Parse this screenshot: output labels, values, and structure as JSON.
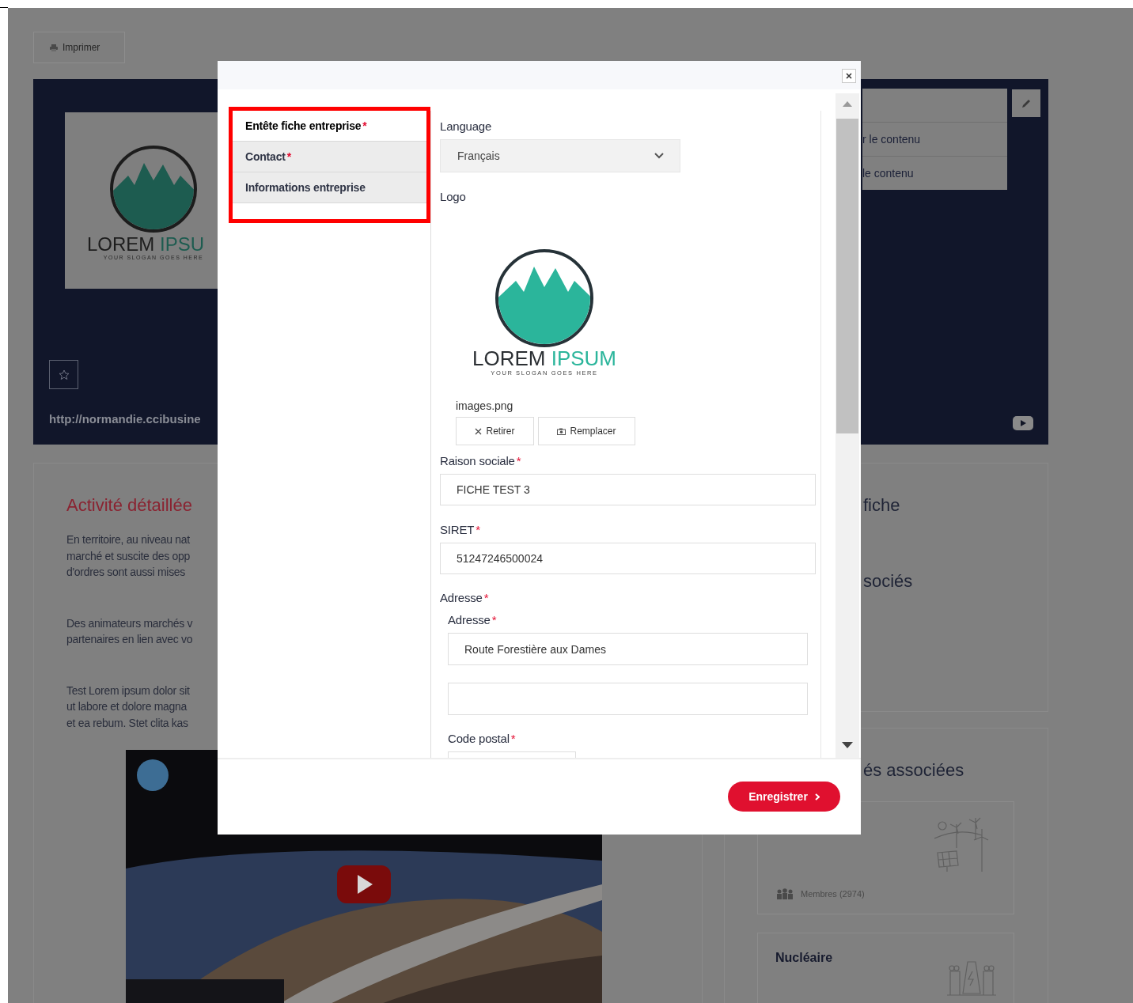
{
  "toolbar": {
    "print_button": "Imprimer"
  },
  "hero": {
    "logo": {
      "name_part_1": "LOREM",
      "name_part_2": "IPSU",
      "slogan": "YOUR SLOGAN GOES HERE"
    },
    "url": "http://normandie.ccibusine",
    "menu_items": [
      "r le contenu",
      "le contenu"
    ]
  },
  "activity": {
    "title": "Activité détaillée",
    "paragraphs": [
      [
        "En territoire, au niveau nat",
        "marché et suscite des opp",
        "d'ordres sont aussi mises"
      ],
      [
        "Des animateurs marchés v",
        "partenaires en lien avec vo"
      ],
      [
        "Test Lorem ipsum dolor sit",
        "ut labore et dolore magna",
        "et ea rebum. Stet clita kas"
      ]
    ],
    "video": {
      "kind": "picture"
    }
  },
  "side_panel": {
    "headings": [
      "fiche",
      "sociés"
    ]
  },
  "associated": {
    "title": "és associées",
    "items": [
      {
        "kind": "renewable",
        "members": "Membres (2974)"
      },
      {
        "kind": "nuclear",
        "title": "Nucléaire"
      }
    ]
  },
  "modal": {
    "tabs": [
      {
        "label": "Entête fiche entreprise",
        "required_mark": "*",
        "selected": true
      },
      {
        "label": "Contact",
        "required_mark": "*",
        "selected": false
      },
      {
        "label": "Informations entreprise",
        "selected": false
      }
    ],
    "language": {
      "label": "Language",
      "value": "Français"
    },
    "logo": {
      "label": "Logo",
      "image": {
        "name_part_1": "LOREM",
        "name_part_2": "IPSUM",
        "slogan": "YOUR SLOGAN GOES HERE"
      },
      "file_name": "images.png",
      "remove_button": "Retirer",
      "replace_button": "Remplacer"
    },
    "fields": [
      {
        "label": "Raison sociale",
        "required_mark": "*",
        "value": "FICHE TEST 3"
      },
      {
        "label": "SIRET",
        "required_mark": "*",
        "value": "51247246500024"
      }
    ],
    "address": {
      "label": "Adresse",
      "required_mark": "*",
      "street": {
        "label": "Adresse",
        "required_mark": "*",
        "value": "Route Forestière aux Dames"
      },
      "postal_code": {
        "label": "Code postal",
        "required_mark": "*"
      }
    },
    "save_button": "Enregistrer"
  }
}
